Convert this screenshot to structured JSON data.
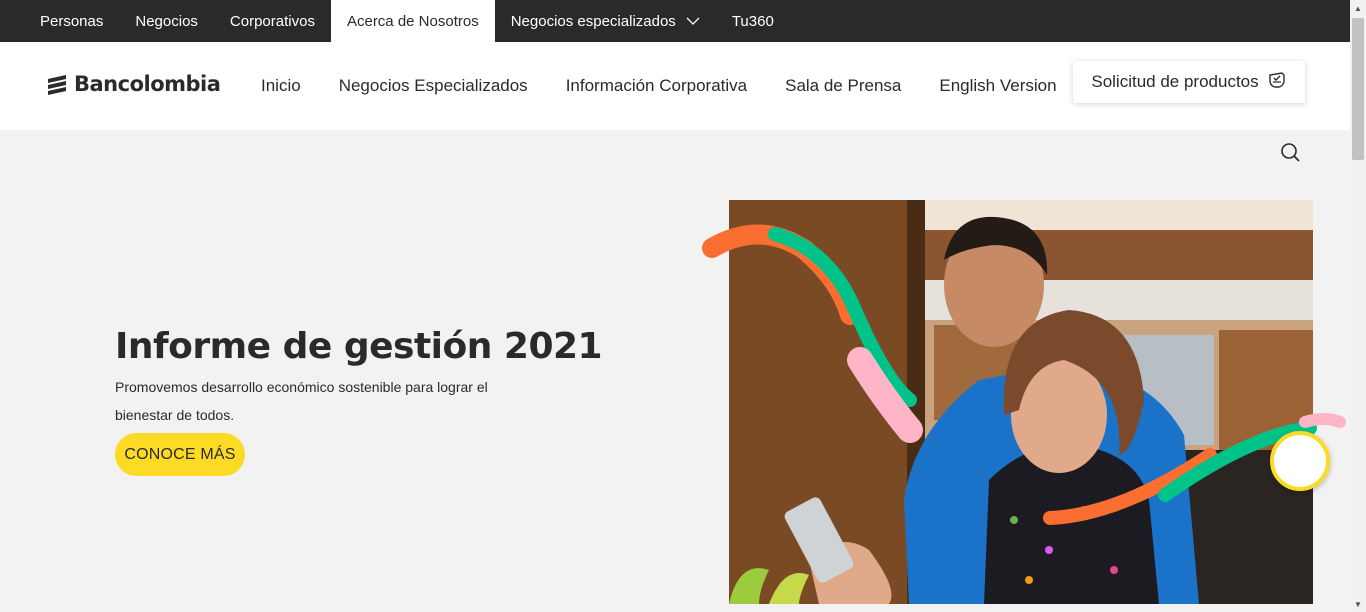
{
  "topbar": {
    "items": [
      {
        "label": "Personas"
      },
      {
        "label": "Negocios"
      },
      {
        "label": "Corporativos"
      },
      {
        "label": "Acerca de Nosotros",
        "active": true
      },
      {
        "label": "Negocios especializados",
        "has_dropdown": true
      },
      {
        "label": "Tu360"
      }
    ]
  },
  "header": {
    "logo_text": "Bancolombia",
    "nav": [
      {
        "label": "Inicio"
      },
      {
        "label": "Negocios Especializados"
      },
      {
        "label": "Información Corporativa"
      },
      {
        "label": "Sala de Prensa"
      },
      {
        "label": "English Version"
      }
    ],
    "solicitud_label": "Solicitud de productos",
    "solicitud_icon": "hand-product-icon"
  },
  "search": {
    "icon": "search-icon"
  },
  "hero": {
    "title": "Informe de gestión 2021",
    "subtitle": "Promovemos desarrollo económico sostenible para lograr el bienestar de todos.",
    "cta_label": "CONOCE MÁS"
  },
  "colors": {
    "topbar_bg": "#2c2a29",
    "brand_yellow": "#fdda24",
    "swirl_orange": "#fa6e32",
    "swirl_green": "#00c389",
    "swirl_pink": "#ffb4c8",
    "page_bg": "#f2f2f2"
  }
}
